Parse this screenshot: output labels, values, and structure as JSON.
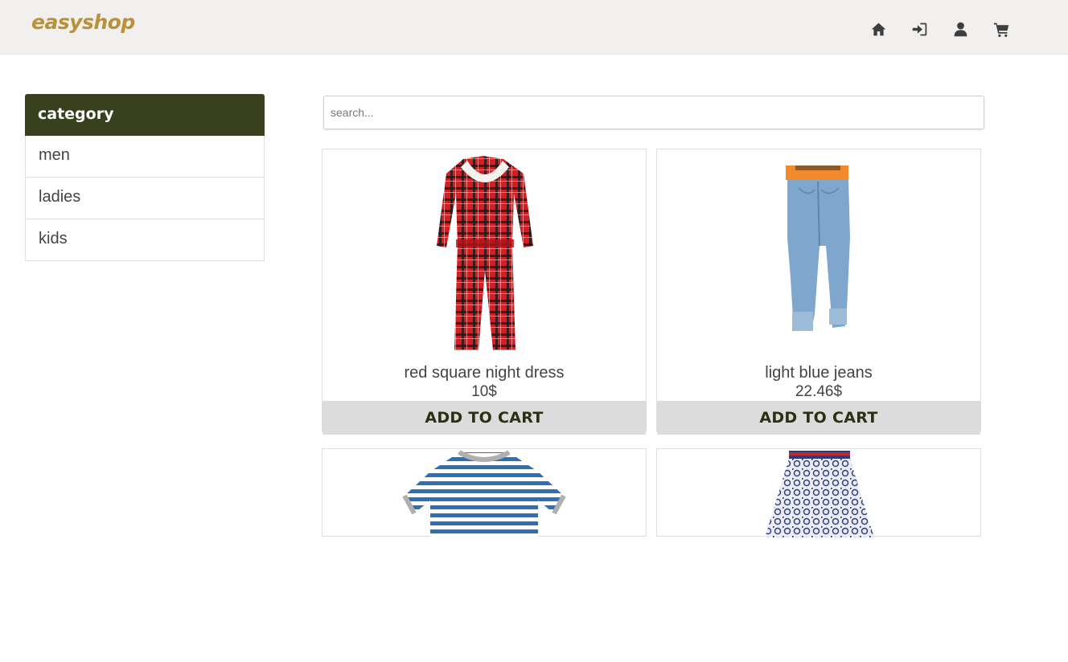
{
  "header": {
    "brand": "easyshop",
    "icons": [
      "home-icon",
      "sign-in-icon",
      "user-icon",
      "cart-icon"
    ]
  },
  "sidebar": {
    "title": "category",
    "items": [
      {
        "label": "men"
      },
      {
        "label": "ladies"
      },
      {
        "label": "kids"
      }
    ]
  },
  "search": {
    "placeholder": "search..."
  },
  "products": [
    {
      "name": "red square night dress",
      "price": "10$",
      "button": "ADD TO CART",
      "image": "red plaid pajamas"
    },
    {
      "name": "light blue jeans",
      "price": "22.46$",
      "button": "ADD TO CART",
      "image": "light blue jeans"
    },
    {
      "image": "blue striped shirt"
    },
    {
      "image": "patterned skirt"
    }
  ],
  "colors": {
    "brand": "#b8913a",
    "header_bg": "#f1f0ee",
    "category_header": "#38401d",
    "button_bg": "#dcdcdc"
  }
}
